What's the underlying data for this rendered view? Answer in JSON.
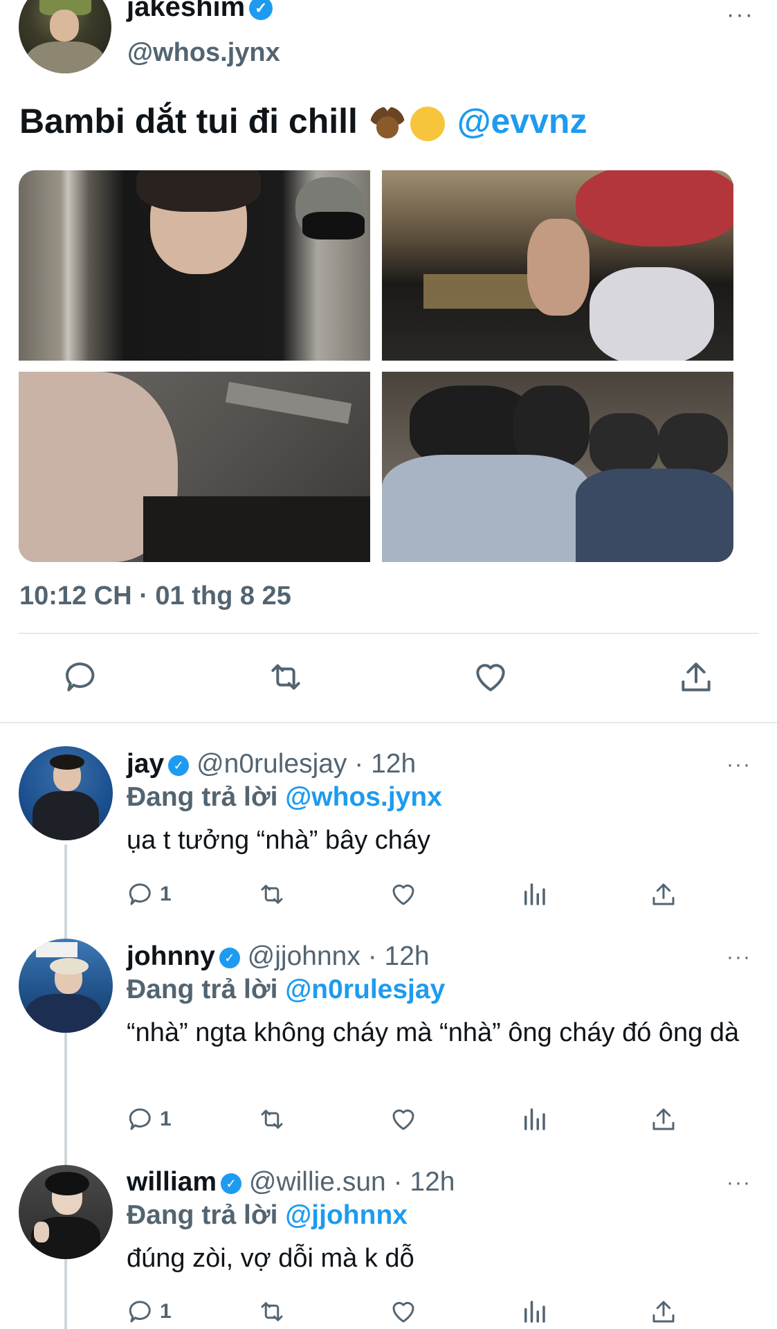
{
  "tweet": {
    "display_name": "jakeshim",
    "handle": "@whos.jynx",
    "text": "Bambi dắt tui đi chill",
    "mention": "@evvnz",
    "timestamp": "10:12 CH · 01 thg 8 25",
    "more": "···"
  },
  "replies": [
    {
      "display_name": "jay",
      "handle": "@n0rulesjay",
      "time": "· 12h",
      "replying_label": "Đang trả lời",
      "replying_to": "@whos.jynx",
      "text": "ụa t tưởng “nhà” bây cháy",
      "reply_count": "1",
      "more": "···"
    },
    {
      "display_name": "johnny",
      "handle": "@jjohnnx",
      "time": "· 12h",
      "replying_label": "Đang trả lời",
      "replying_to": "@n0rulesjay",
      "text": "“nhà” ngta không cháy mà “nhà” ông cháy đó ông dà",
      "reply_count": "1",
      "more": "···"
    },
    {
      "display_name": "william",
      "handle": "@willie.sun",
      "time": "· 12h",
      "replying_label": "Đang trả lời",
      "replying_to": "@jjohnnx",
      "text": "đúng zòi, vợ dỗi mà k dỗ",
      "reply_count": "1",
      "more": "···"
    }
  ],
  "colors": {
    "accent": "#1d9bf0",
    "secondary_text": "#536471",
    "divider": "#e6e9eb"
  }
}
